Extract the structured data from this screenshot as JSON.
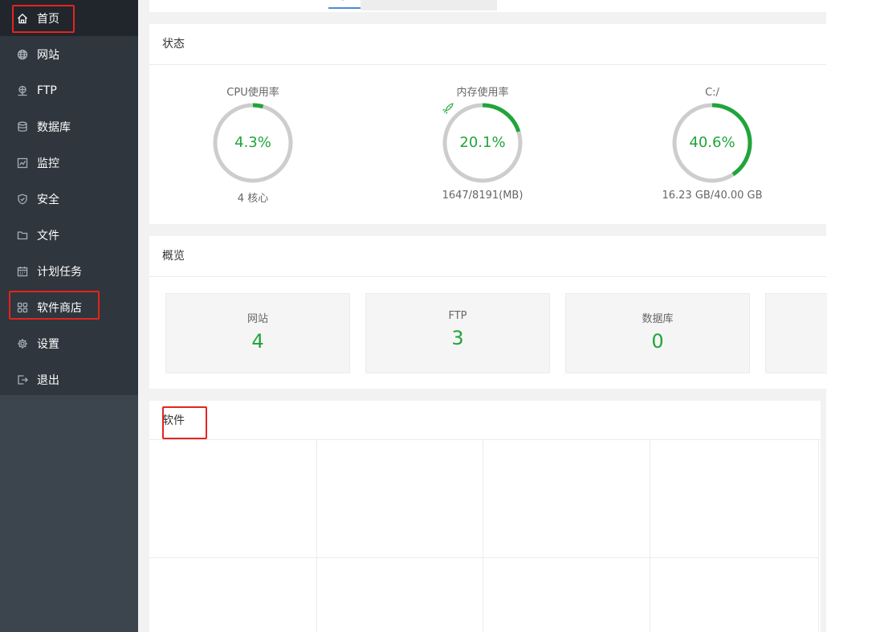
{
  "sidebar": {
    "items": [
      {
        "label": "首页",
        "icon": "home-icon",
        "active": true
      },
      {
        "label": "网站",
        "icon": "globe-icon"
      },
      {
        "label": "FTP",
        "icon": "ftp-icon"
      },
      {
        "label": "数据库",
        "icon": "database-icon"
      },
      {
        "label": "监控",
        "icon": "monitor-icon"
      },
      {
        "label": "安全",
        "icon": "shield-icon"
      },
      {
        "label": "文件",
        "icon": "folder-icon"
      },
      {
        "label": "计划任务",
        "icon": "calendar-icon"
      },
      {
        "label": "软件商店",
        "icon": "grid-icon"
      },
      {
        "label": "设置",
        "icon": "gear-icon"
      },
      {
        "label": "退出",
        "icon": "logout-icon"
      }
    ]
  },
  "status": {
    "title": "状态",
    "gauges": [
      {
        "label": "CPU使用率",
        "value": "4.3%",
        "percent": 4.3,
        "sub": "4 核心"
      },
      {
        "label": "内存使用率",
        "value": "20.1%",
        "percent": 20.1,
        "sub": "1647/8191(MB)"
      },
      {
        "label": "C:/",
        "value": "40.6%",
        "percent": 40.6,
        "sub": "16.23 GB/40.00 GB"
      }
    ]
  },
  "overview": {
    "title": "概览",
    "tiles": [
      {
        "name": "网站",
        "value": "4"
      },
      {
        "name": "FTP",
        "value": "3"
      },
      {
        "name": "数据库",
        "value": "0"
      }
    ]
  },
  "software": {
    "title": "软件"
  },
  "colors": {
    "accent_green": "#20a53a",
    "highlight_red": "#e4241e",
    "sidebar_bg": "#2f363d"
  }
}
